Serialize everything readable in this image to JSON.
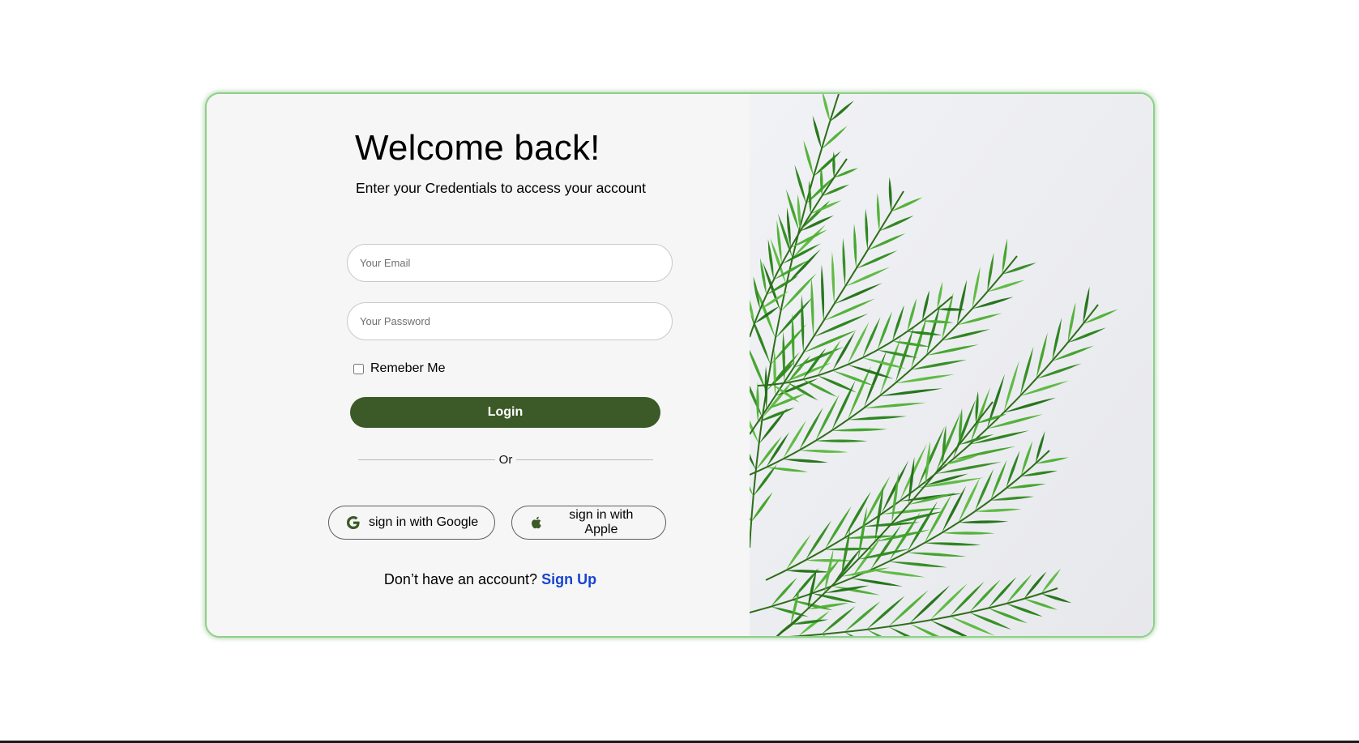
{
  "login": {
    "title": "Welcome back!",
    "subtitle": "Enter your Credentials to access your account",
    "email_placeholder": "Your Email",
    "password_placeholder": "Your Password",
    "remember_label": "Remeber Me",
    "login_label": "Login",
    "divider_label": "Or",
    "google_label": "sign in with Google",
    "apple_label": "sign in with Apple",
    "signup_prompt": "Don’t have an account?",
    "signup_link": "Sign Up"
  },
  "icons": {
    "google": "google-icon",
    "apple": "apple-icon"
  },
  "colors": {
    "accent": "#3b5a27",
    "link": "#1744d1",
    "card_border": "#8fcf8a",
    "card_bg": "#f6f6f6"
  }
}
